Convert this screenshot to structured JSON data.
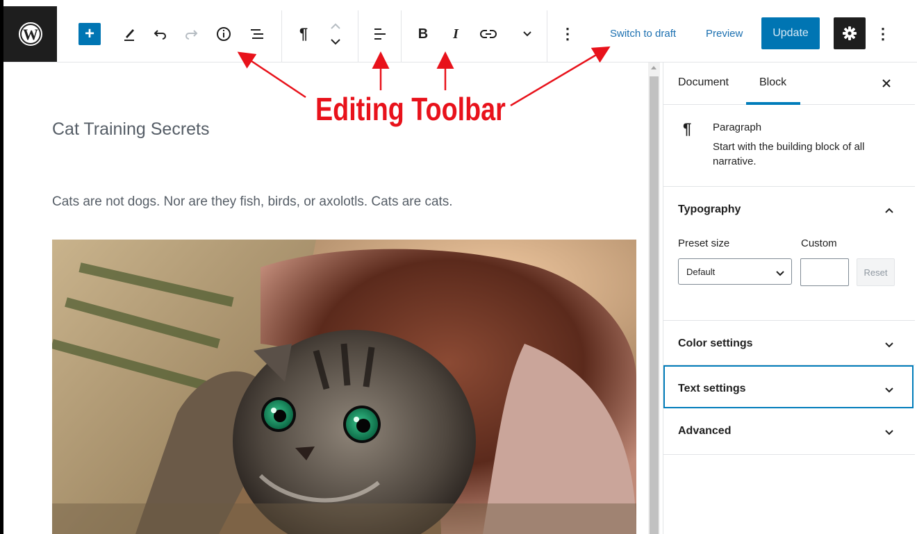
{
  "toolbar": {
    "add_label": "+",
    "switch_to_draft": "Switch to draft",
    "preview": "Preview",
    "update": "Update",
    "icons": [
      "wordpress-logo",
      "add",
      "pencil",
      "undo",
      "redo",
      "info",
      "list-view",
      "paragraph",
      "move-up-down",
      "align",
      "bold",
      "italic",
      "link",
      "more-rich-text",
      "options",
      "settings",
      "more"
    ]
  },
  "annotation": {
    "label": "Editing Toolbar",
    "color": "#e8121b"
  },
  "editor": {
    "title": "Cat Training Secrets",
    "paragraph": "Cats are not dogs. Nor are they fish, birds, or axolotls. Cats are cats."
  },
  "sidebar": {
    "tabs": [
      "Document",
      "Block"
    ],
    "active_tab": "Block",
    "block": {
      "name": "Paragraph",
      "description": "Start with the building block of all narrative."
    },
    "typography": {
      "title": "Typography",
      "preset_label": "Preset size",
      "custom_label": "Custom",
      "preset_value": "Default",
      "custom_value": "",
      "reset": "Reset"
    },
    "panels": [
      "Color settings",
      "Text settings",
      "Advanced"
    ]
  },
  "colors": {
    "accent": "#007cba",
    "update_bg": "#0075b3",
    "dark": "#1e1e1e"
  }
}
